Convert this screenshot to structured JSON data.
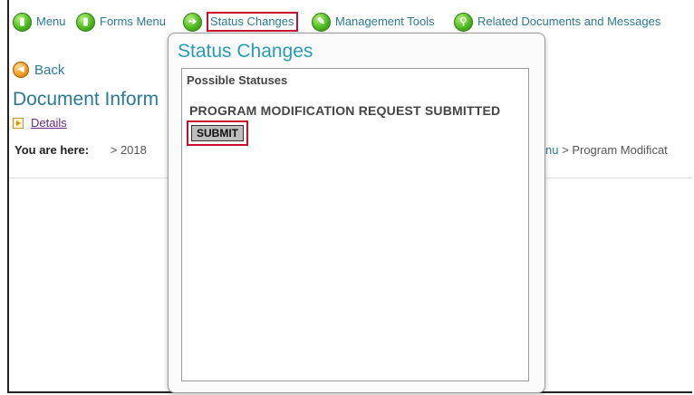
{
  "menubar": {
    "items": [
      {
        "label": "Menu",
        "icon": "green-document-icon"
      },
      {
        "label": "Forms Menu",
        "icon": "green-document-icon"
      },
      {
        "label": "Status Changes",
        "icon": "green-arrow-right-icon"
      },
      {
        "label": "Management Tools",
        "icon": "green-wrench-icon"
      },
      {
        "label": "Related Documents and Messages",
        "icon": "green-search-icon"
      }
    ]
  },
  "nav": {
    "back_label": "Back",
    "page_title": "Document Inform",
    "details_label": "Details"
  },
  "breadcrumb": {
    "prefix": "You are here:",
    "first": "> 2018",
    "right_menu": "nu",
    "right_sep": ">",
    "right_last": "Program Modificat"
  },
  "modal": {
    "title": "Status Changes",
    "section_label": "Possible Statuses",
    "status_name": "PROGRAM MODIFICATION REQUEST SUBMITTED",
    "submit_label": "SUBMIT"
  },
  "colors": {
    "link": "#2a7a94",
    "modal_title": "#2a9bb7",
    "highlight": "#c8102e"
  }
}
